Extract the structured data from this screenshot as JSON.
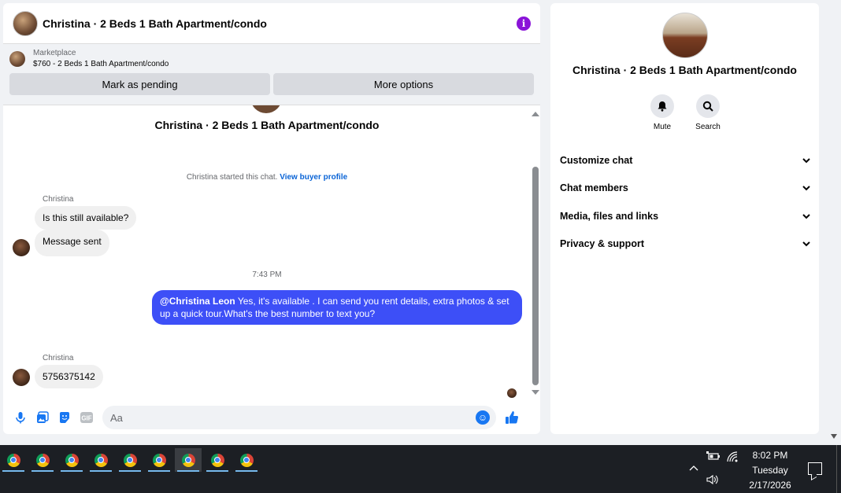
{
  "chat": {
    "title": "Christina · 2 Beds 1 Bath Apartment/condo",
    "info_icon_glyph": "i",
    "marketplace": {
      "label": "Marketplace",
      "listing": "$760 - 2 Beds 1 Bath Apartment/condo",
      "mark_pending_label": "Mark as pending",
      "more_options_label": "More options"
    },
    "thread_title": "Christina · 2 Beds 1 Bath Apartment/condo",
    "started_text": "Christina started this chat.",
    "view_buyer_profile": "View buyer profile",
    "messages": [
      {
        "sender": "Christina",
        "text": "Is this still available?"
      },
      {
        "text": "Message sent"
      }
    ],
    "time_divider": "7:43 PM",
    "outgoing": {
      "mention": "@Christina Leon",
      "text": " Yes, it's available .  I can send you rent details, extra photos & set up a quick tour.What's the best number to text you?"
    },
    "reply": {
      "sender": "Christina",
      "text": "5756375142"
    },
    "composer_placeholder": "Aa",
    "gif_label": "GIF",
    "accent_color": "#3d4ff7"
  },
  "side": {
    "title": "Christina · 2 Beds 1 Bath Apartment/condo",
    "mute_label": "Mute",
    "search_label": "Search",
    "menu": [
      {
        "label": "Customize chat"
      },
      {
        "label": "Chat members"
      },
      {
        "label": "Media, files and links"
      },
      {
        "label": "Privacy & support"
      }
    ]
  },
  "taskbar": {
    "apps": [
      "chrome",
      "chrome",
      "chrome",
      "chrome",
      "chrome",
      "chrome",
      "chrome",
      "chrome",
      "chrome"
    ],
    "active_app_index": 6,
    "clock": {
      "time": "8:02 PM",
      "day": "Tuesday",
      "date": "2/17/2026"
    }
  }
}
